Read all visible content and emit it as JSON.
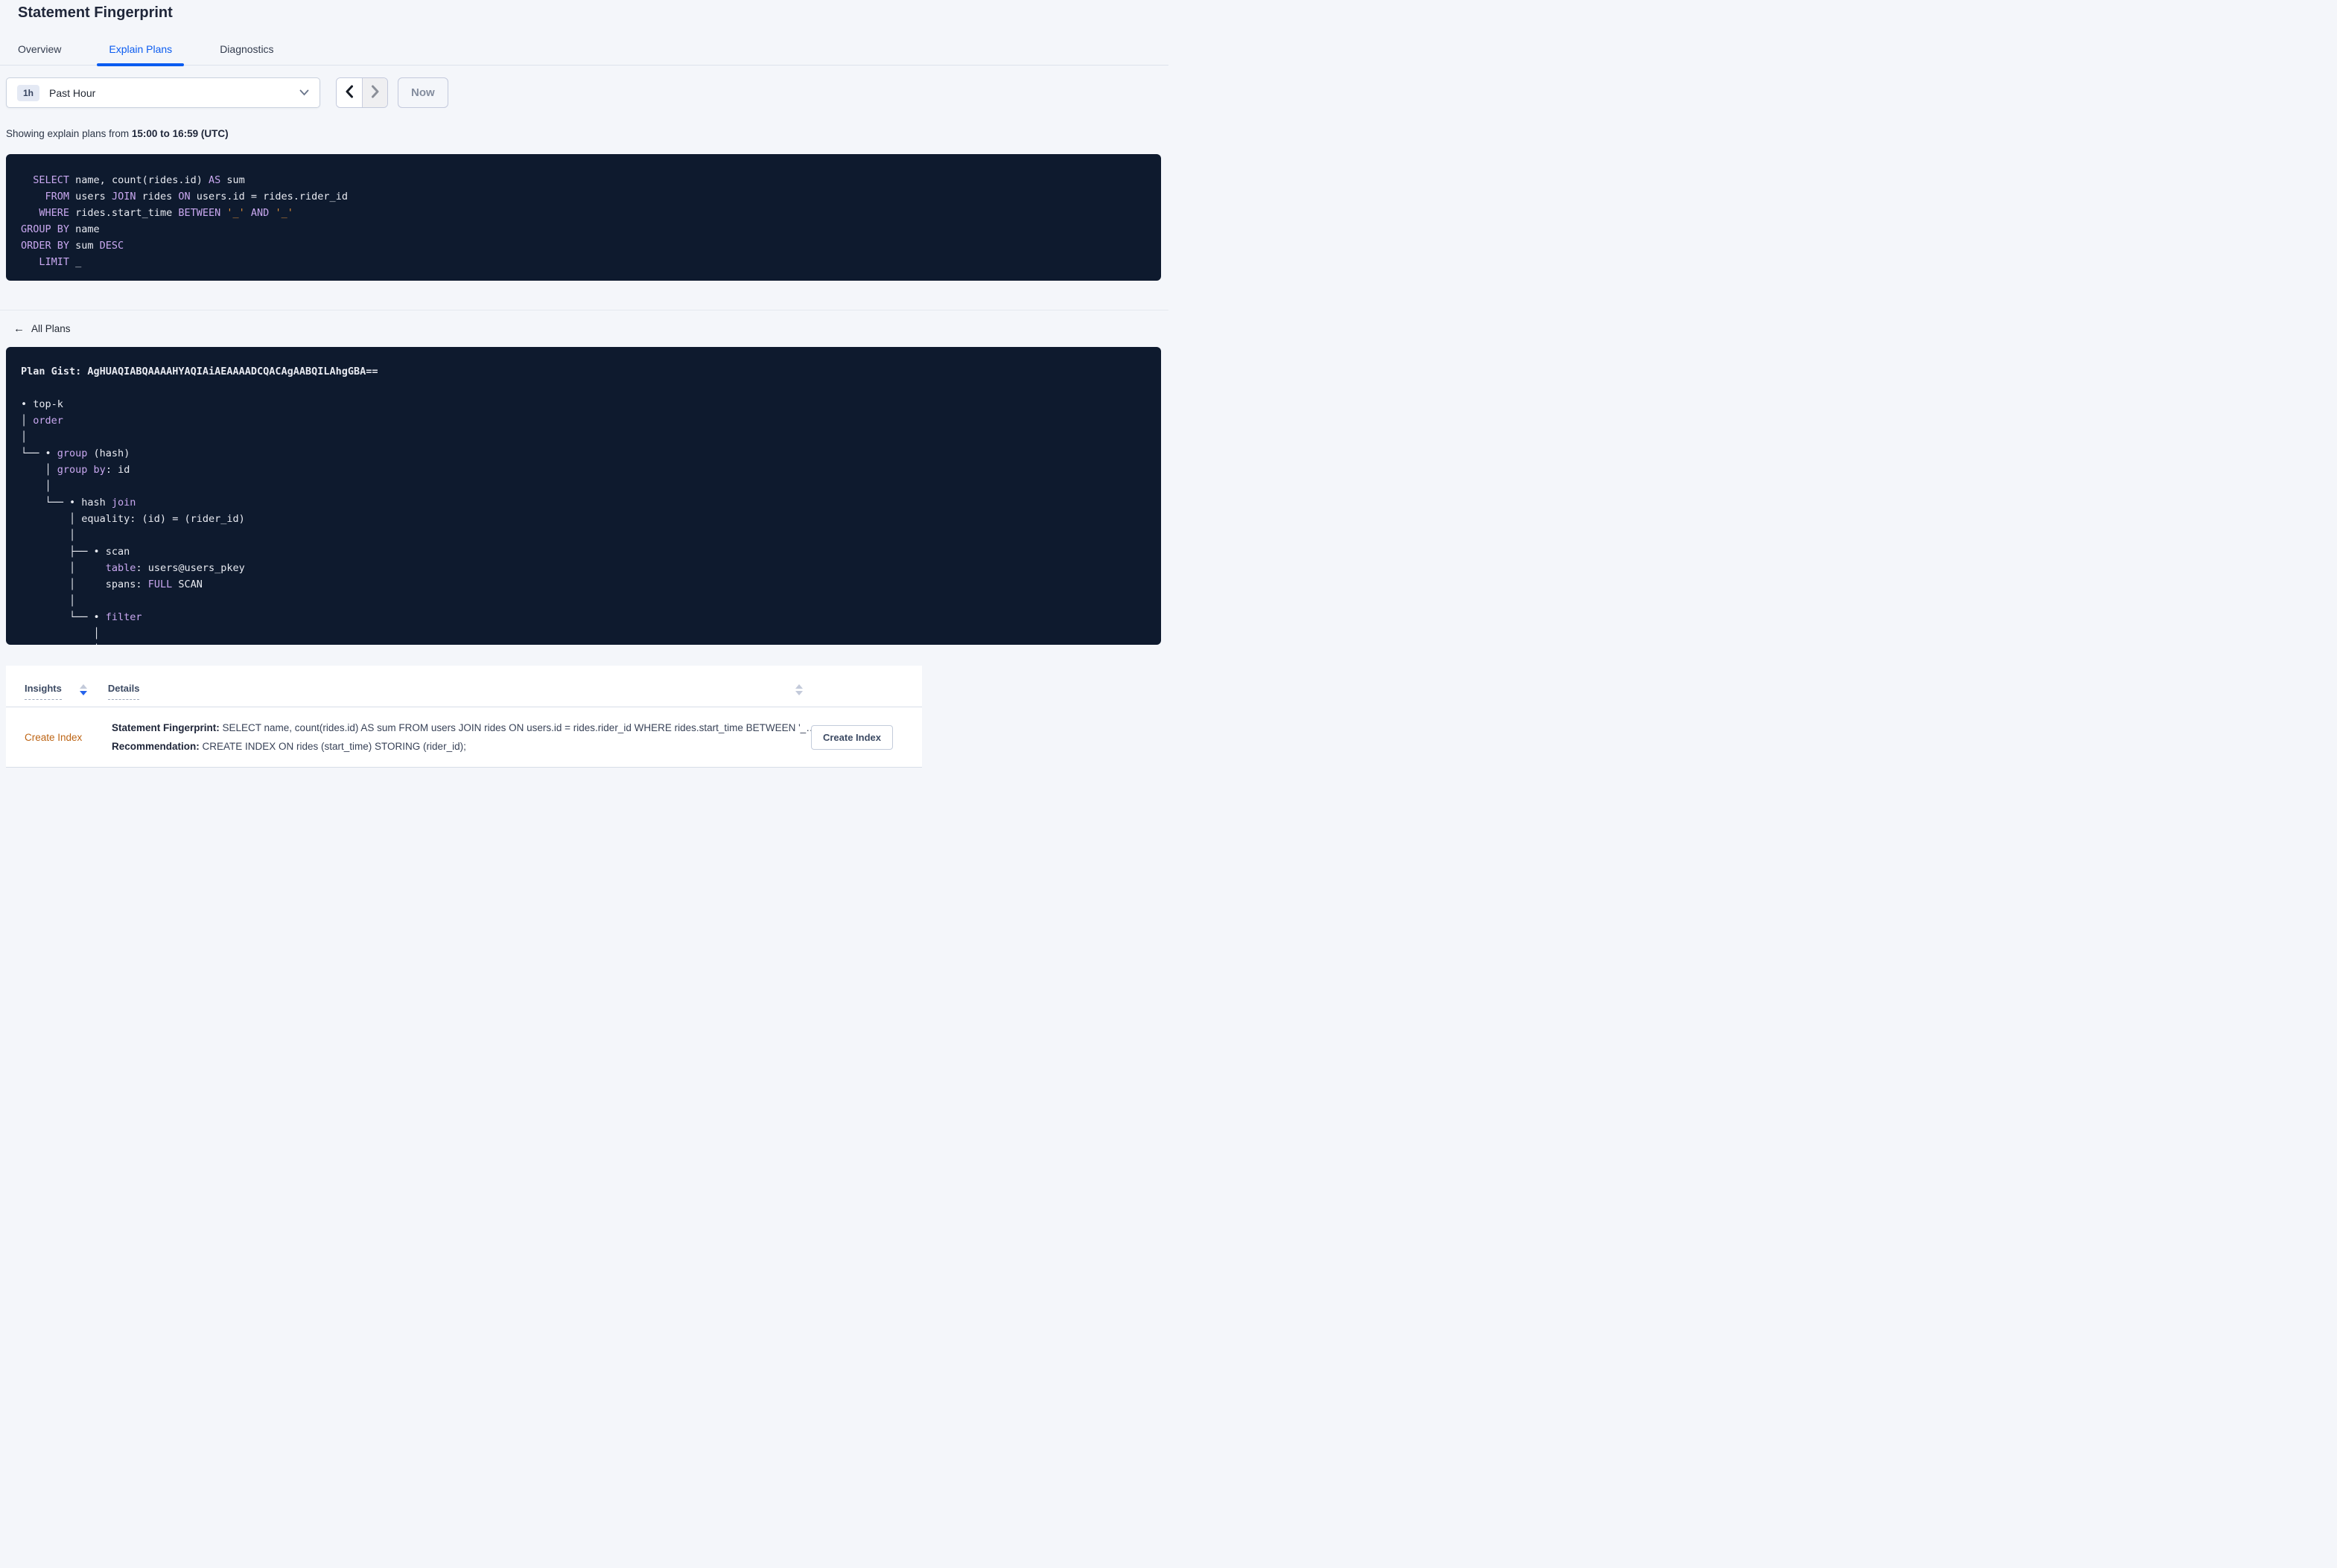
{
  "page_title": "Statement Fingerprint",
  "tabs": {
    "overview": "Overview",
    "explain_plans": "Explain Plans",
    "diagnostics": "Diagnostics"
  },
  "time_picker": {
    "duration_badge": "1h",
    "selected": "Past Hour",
    "now_button": "Now"
  },
  "showing_text": {
    "prefix": "Showing explain plans from ",
    "range_bold": "15:00 to 16:59 (UTC)"
  },
  "sql_statement": {
    "lines": [
      [
        {
          "c": "pl",
          "v": "  "
        },
        {
          "c": "kw",
          "v": "SELECT"
        },
        {
          "c": "pl",
          "v": " name, count(rides.id) "
        },
        {
          "c": "kw",
          "v": "AS"
        },
        {
          "c": "pl",
          "v": " sum"
        }
      ],
      [
        {
          "c": "pl",
          "v": "    "
        },
        {
          "c": "kw",
          "v": "FROM"
        },
        {
          "c": "pl",
          "v": " users "
        },
        {
          "c": "kw",
          "v": "JOIN"
        },
        {
          "c": "pl",
          "v": " rides "
        },
        {
          "c": "kw",
          "v": "ON"
        },
        {
          "c": "pl",
          "v": " users.id = rides.rider_id"
        }
      ],
      [
        {
          "c": "pl",
          "v": "   "
        },
        {
          "c": "kw",
          "v": "WHERE"
        },
        {
          "c": "pl",
          "v": " rides.start_time "
        },
        {
          "c": "kw",
          "v": "BETWEEN"
        },
        {
          "c": "pl",
          "v": " "
        },
        {
          "c": "str",
          "v": "'_'"
        },
        {
          "c": "pl",
          "v": " "
        },
        {
          "c": "kw",
          "v": "AND"
        },
        {
          "c": "pl",
          "v": " "
        },
        {
          "c": "str",
          "v": "'_'"
        }
      ],
      [
        {
          "c": "kw",
          "v": "GROUP BY"
        },
        {
          "c": "pl",
          "v": " name"
        }
      ],
      [
        {
          "c": "kw",
          "v": "ORDER BY"
        },
        {
          "c": "pl",
          "v": " sum "
        },
        {
          "c": "kw",
          "v": "DESC"
        }
      ],
      [
        {
          "c": "pl",
          "v": "   "
        },
        {
          "c": "kw",
          "v": "LIMIT"
        },
        {
          "c": "pl",
          "v": " _"
        }
      ]
    ]
  },
  "back_link_label": "All Plans",
  "plan_details": {
    "gist_label": "Plan Gist: ",
    "gist": "AgHUAQIABQAAAAHYAQIAiAEAAAADCQACAgAABQILAhgGBA==",
    "tree": [
      [
        {
          "c": "pl",
          "v": "• top-k"
        }
      ],
      [
        {
          "c": "pl",
          "v": "│ "
        },
        {
          "c": "kw",
          "v": "order"
        }
      ],
      [
        {
          "c": "pl",
          "v": "│"
        }
      ],
      [
        {
          "c": "pl",
          "v": "└── • "
        },
        {
          "c": "kw",
          "v": "group"
        },
        {
          "c": "pl",
          "v": " (hash)"
        }
      ],
      [
        {
          "c": "pl",
          "v": "    │ "
        },
        {
          "c": "kw",
          "v": "group by"
        },
        {
          "c": "pl",
          "v": ": id"
        }
      ],
      [
        {
          "c": "pl",
          "v": "    │"
        }
      ],
      [
        {
          "c": "pl",
          "v": "    └── • hash "
        },
        {
          "c": "kw",
          "v": "join"
        }
      ],
      [
        {
          "c": "pl",
          "v": "        │ equality: (id) = (rider_id)"
        }
      ],
      [
        {
          "c": "pl",
          "v": "        │"
        }
      ],
      [
        {
          "c": "pl",
          "v": "        ├── • scan"
        }
      ],
      [
        {
          "c": "pl",
          "v": "        │     "
        },
        {
          "c": "kw",
          "v": "table"
        },
        {
          "c": "pl",
          "v": ": users@users_pkey"
        }
      ],
      [
        {
          "c": "pl",
          "v": "        │     spans: "
        },
        {
          "c": "kw",
          "v": "FULL"
        },
        {
          "c": "pl",
          "v": " SCAN"
        }
      ],
      [
        {
          "c": "pl",
          "v": "        │"
        }
      ],
      [
        {
          "c": "pl",
          "v": "        └── • "
        },
        {
          "c": "kw",
          "v": "filter"
        }
      ],
      [
        {
          "c": "pl",
          "v": "            │"
        }
      ],
      [
        {
          "c": "pl",
          "v": "            │"
        }
      ]
    ]
  },
  "insights_table": {
    "col_insights": "Insights",
    "col_details": "Details",
    "rows": [
      {
        "insight": "Create Index",
        "fingerprint_label": "Statement Fingerprint:",
        "fingerprint_text": " SELECT name, count(rides.id) AS sum FROM users JOIN rides ON users.id = rides.rider_id WHERE rides.start_time BETWEEN '_…",
        "recommendation_label": "Recommendation:",
        "recommendation_text": " CREATE INDEX ON rides (start_time) STORING (rider_id);",
        "action_button": "Create Index"
      }
    ]
  },
  "colors": {
    "accent_blue": "#0b5cf0",
    "keyword_purple": "#c9a8f0",
    "literal_orange": "#de8e37",
    "insight_orange": "#bd6414",
    "code_background": "#0e1a2e"
  }
}
